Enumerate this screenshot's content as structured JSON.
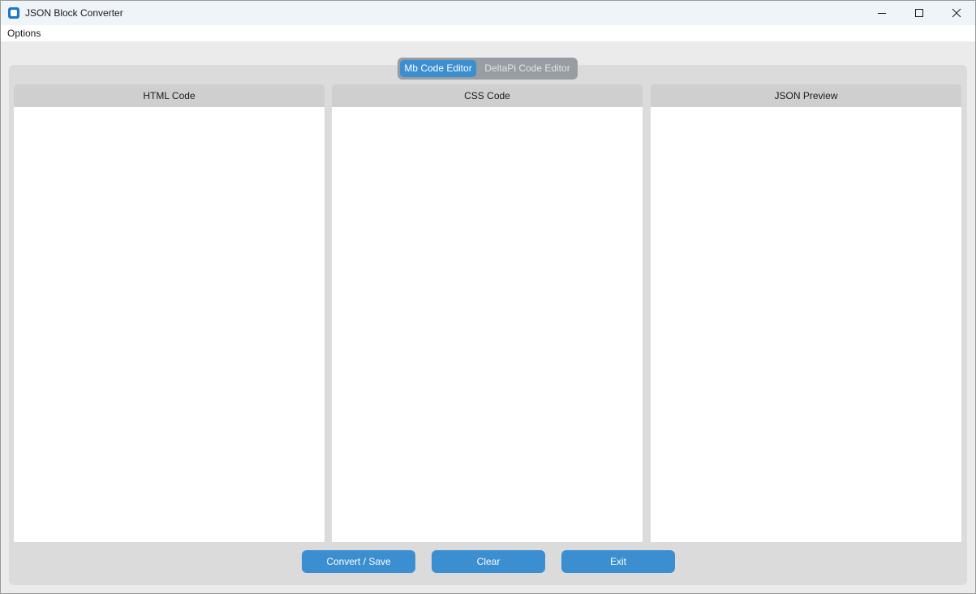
{
  "window": {
    "title": "JSON Block Converter",
    "icon": "app-icon"
  },
  "menu": {
    "items": [
      {
        "label": "Options"
      }
    ]
  },
  "tabs": [
    {
      "label": "Mb Code Editor",
      "active": true
    },
    {
      "label": "DeltaPi Code Editor",
      "active": false
    }
  ],
  "panels": [
    {
      "title": "HTML Code",
      "content": ""
    },
    {
      "title": "CSS Code",
      "content": ""
    },
    {
      "title": "JSON Preview",
      "content": ""
    }
  ],
  "buttons": {
    "convert": "Convert / Save",
    "clear": "Clear",
    "exit": "Exit"
  },
  "colors": {
    "accent": "#3b8ed0",
    "tab_bar": "#979da2",
    "panel_header": "#cfcfcf",
    "frame_bg": "#dbdbdb",
    "window_bg": "#ebebeb"
  }
}
